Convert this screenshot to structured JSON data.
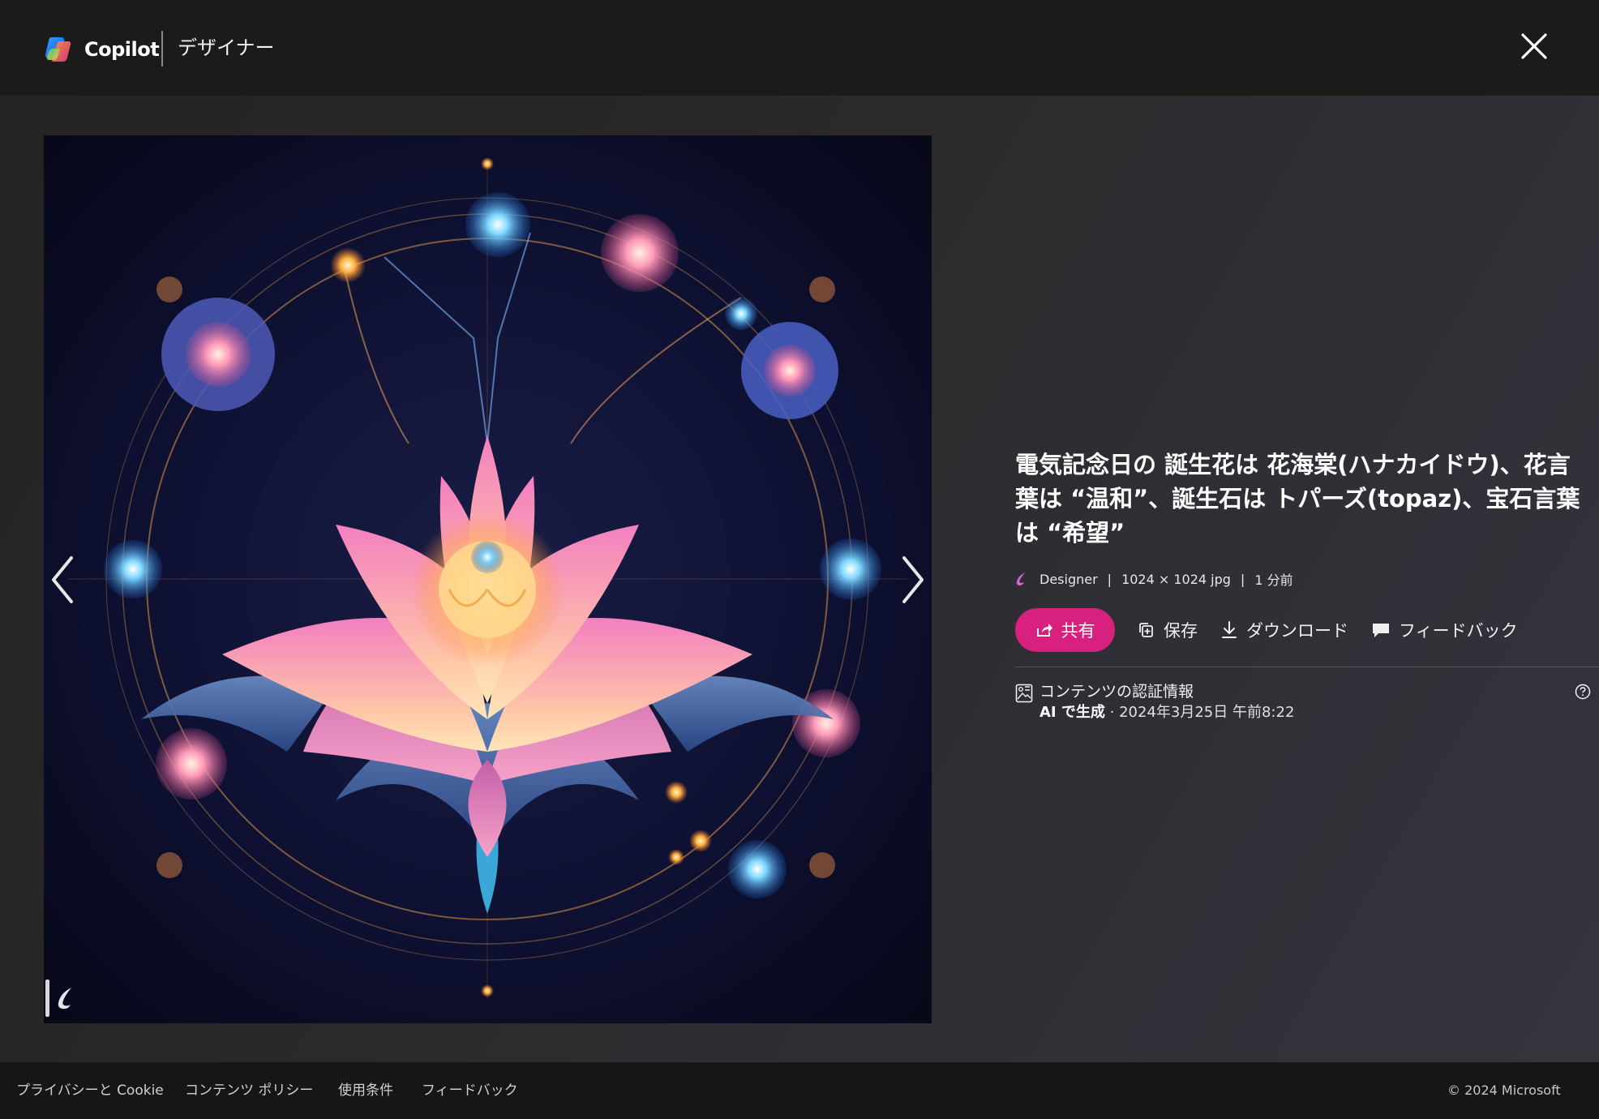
{
  "header": {
    "brand": "Copilot",
    "product": "デザイナー",
    "close_icon": "close-icon",
    "logo_icon": "copilot-logo-icon"
  },
  "image": {
    "description_icon": "generated-lotus-image",
    "prev_icon": "chevron-left-icon",
    "next_icon": "chevron-right-icon",
    "watermark_icon": "designer-watermark-icon"
  },
  "details": {
    "title": "電気記念日の 誕生花は 花海棠(ハナカイドウ)、花言葉は “温和”、誕生石は トパーズ(topaz)、宝石言葉は “希望”",
    "meta": {
      "creator": "Designer",
      "dimensions": "1024 × 1024 jpg",
      "time": "1 分前"
    },
    "actions": {
      "share": "共有",
      "save": "保存",
      "download": "ダウンロード",
      "feedback": "フィードバック"
    },
    "credentials": {
      "title": "コンテンツの認証情報",
      "ai_label": "AI で生成",
      "date": "· 2024年3月25日 午前8:22"
    }
  },
  "footer": {
    "links": [
      "プライバシーと Cookie",
      "コンテンツ ポリシー",
      "使用条件",
      "フィードバック"
    ],
    "copyright": "© 2024 Microsoft"
  },
  "colors": {
    "accent": "#d8207f",
    "background": "#1c1b1a",
    "footer": "#161616"
  }
}
